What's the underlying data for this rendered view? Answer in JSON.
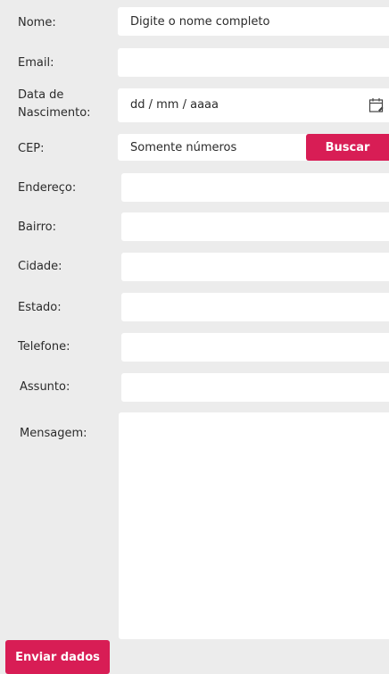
{
  "form": {
    "name": {
      "label": "Nome:",
      "placeholder": "Digite o nome completo"
    },
    "email": {
      "label": "Email:",
      "placeholder": ""
    },
    "birthdate": {
      "label_line1": "Data de",
      "label_line2": "Nascimento:",
      "placeholder": "dd / mm / aaaa",
      "icon": "calendar-icon"
    },
    "cep": {
      "label": "CEP:",
      "placeholder": "Somente números",
      "search_button": "Buscar"
    },
    "address": {
      "label": "Endereço:"
    },
    "district": {
      "label": "Bairro:"
    },
    "city": {
      "label": "Cidade:"
    },
    "state": {
      "label": "Estado:"
    },
    "phone": {
      "label": "Telefone:"
    },
    "subject": {
      "label": "Assunto:"
    },
    "message": {
      "label": "Mensagem:"
    },
    "submit_button": "Enviar dados"
  },
  "colors": {
    "background": "#ececec",
    "field": "#ffffff",
    "accent": "#d81d55",
    "text": "#2b2b2b"
  }
}
